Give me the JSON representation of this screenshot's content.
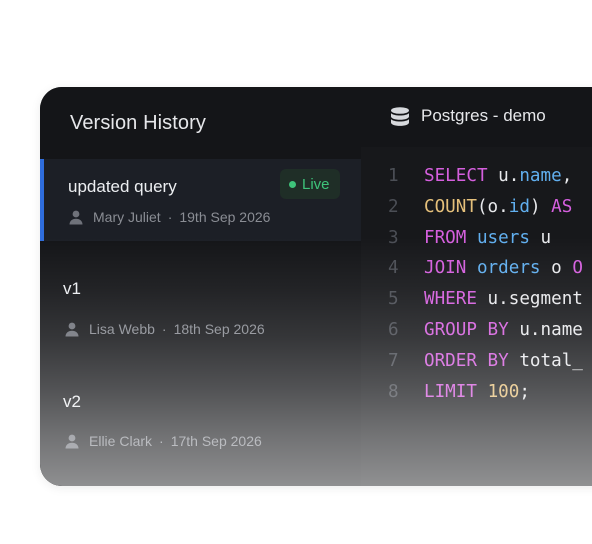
{
  "sidebar": {
    "title": "Version History",
    "versions": [
      {
        "name": "updated query",
        "badge": "Live",
        "author": "Mary Juliet",
        "separator": "·",
        "date": "19th Sep 2026",
        "active": true
      },
      {
        "name": "v1",
        "author": "Lisa Webb",
        "separator": "·",
        "date": "18th Sep 2026",
        "active": false
      },
      {
        "name": "v2",
        "author": "Ellie Clark",
        "separator": "·",
        "date": "17th Sep 2026",
        "active": false
      }
    ]
  },
  "editor": {
    "connection_label": "Postgres - demo",
    "connection_icon": "database-icon",
    "line_numbers": [
      "1",
      "2",
      "3",
      "4",
      "5",
      "6",
      "7",
      "8"
    ],
    "code": {
      "l1": {
        "kw": "SELECT",
        "a": " u.",
        "b": "name",
        "c": ", "
      },
      "l2": {
        "fn": "COUNT",
        "a": "(o.",
        "b": "id",
        "c": ") ",
        "kw": "AS"
      },
      "l3": {
        "kw": "FROM",
        "a": " ",
        "b": "users",
        "c": " u"
      },
      "l4": {
        "kw": "JOIN",
        "a": " ",
        "b": "orders",
        "c": " o ",
        "kw2": "O"
      },
      "l5": {
        "kw": "WHERE",
        "a": " u.segment"
      },
      "l6": {
        "kw": "GROUP BY",
        "a": " u.name"
      },
      "l7": {
        "kw": "ORDER BY",
        "a": " total_"
      },
      "l8": {
        "kw": "LIMIT",
        "a": " ",
        "num": "100",
        "c": ";"
      }
    }
  },
  "colors": {
    "accent": "#2f6ddc",
    "live": "#3ec37a",
    "keyword": "#d55fde",
    "function": "#e5c07b",
    "identifier": "#61afef"
  }
}
